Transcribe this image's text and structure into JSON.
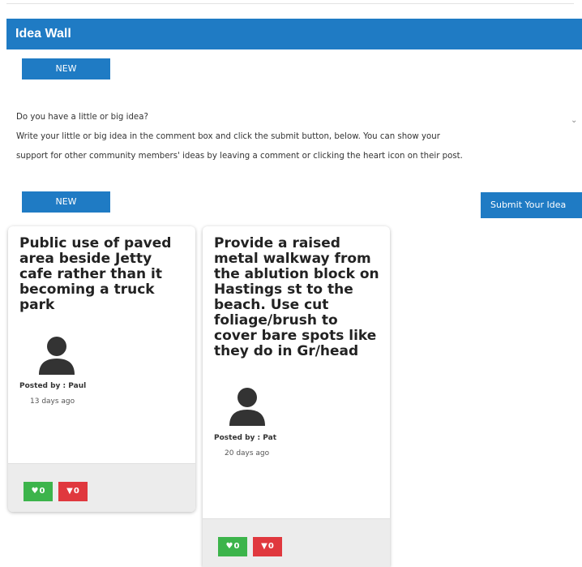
{
  "header": {
    "title": "Idea Wall"
  },
  "buttons": {
    "new_label": "NEW",
    "submit_label": "Submit Your Idea"
  },
  "intro": {
    "line1": "Do you have a little or big idea?",
    "line2": "Write your little or big idea in the comment box and click the submit button, below. You can show your",
    "line3": "support for other community members' ideas by leaving a comment or clicking the heart icon on their post.",
    "expand_icon": "chevron-down-icon"
  },
  "ideas": [
    {
      "title": "Public use of paved area beside Jetty cafe rather than it becoming a truck park",
      "posted_by": "Posted by : Paul",
      "age": "13 days ago",
      "likes": "0",
      "dislikes": "0"
    },
    {
      "title": "Provide a raised metal walkway from the ablution block on Hastings st to the beach. Use cut foliage/brush to cover bare spots like they do in Gr/head",
      "posted_by": "Posted by : Pat",
      "age": "20 days ago",
      "likes": "0",
      "dislikes": "0"
    }
  ],
  "colors": {
    "brand_blue": "#1f7bc4",
    "like_green": "#3cb44b",
    "dislike_red": "#e0383e",
    "footer_gray": "#ececec"
  },
  "icons": {
    "avatar": "user-avatar-icon",
    "like": "heart-icon",
    "dislike": "thumbs-down-icon"
  }
}
